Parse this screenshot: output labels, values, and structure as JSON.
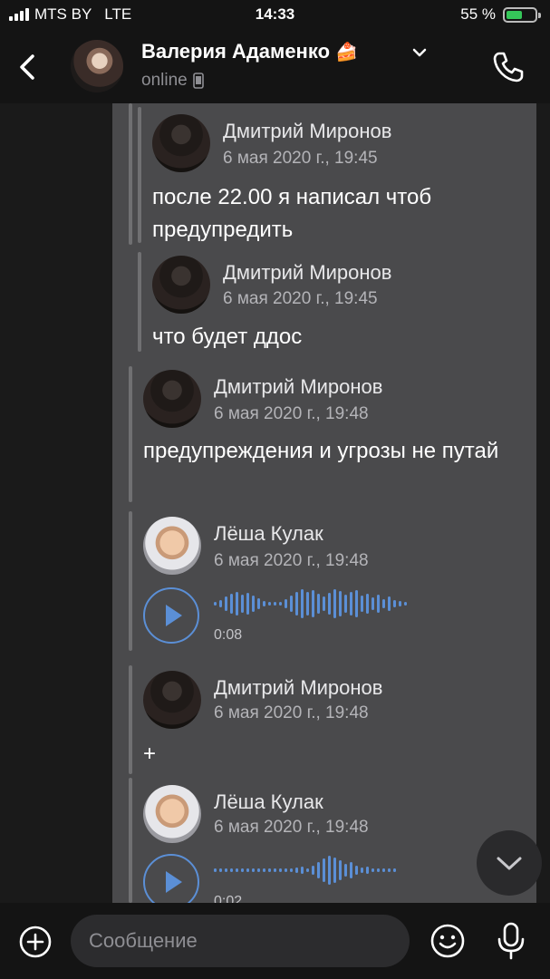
{
  "status_bar": {
    "carrier": "MTS BY",
    "network": "LTE",
    "time": "14:33",
    "battery": "55 %",
    "battery_level": 0.55
  },
  "header": {
    "name": "Валерия Адаменко",
    "emoji": "🍰",
    "status": "online"
  },
  "messages": [
    {
      "author": "Дмитрий Миронов",
      "date": "6 мая 2020 г., 19:45",
      "text": "после 22.00 я написал чтоб предупредить",
      "avatar": "dmitry-avatar"
    },
    {
      "author": "Дмитрий Миронов",
      "date": "6 мая 2020 г., 19:45",
      "text": "что будет ддос",
      "avatar": "dmitry-avatar"
    },
    {
      "author": "Дмитрий Миронов",
      "date": "6 мая 2020 г., 19:48",
      "text": "предупреждения и угрозы не путай",
      "avatar": "dmitry-avatar"
    },
    {
      "author": "Лёша Кулак",
      "date": "6 мая 2020 г., 19:48",
      "voice_duration": "0:08",
      "avatar": "lesha-avatar"
    },
    {
      "author": "Дмитрий Миронов",
      "date": "6 мая 2020 г., 19:48",
      "text": "+",
      "avatar": "dmitry-avatar"
    },
    {
      "author": "Лёша Кулак",
      "date": "6 мая 2020 г., 19:48",
      "voice_duration": "0:02",
      "avatar": "lesha-avatar"
    }
  ],
  "input": {
    "placeholder": "Сообщение"
  },
  "colors": {
    "accent": "#5b8fd6",
    "panel": "#4a4a4c",
    "background": "#141414"
  }
}
